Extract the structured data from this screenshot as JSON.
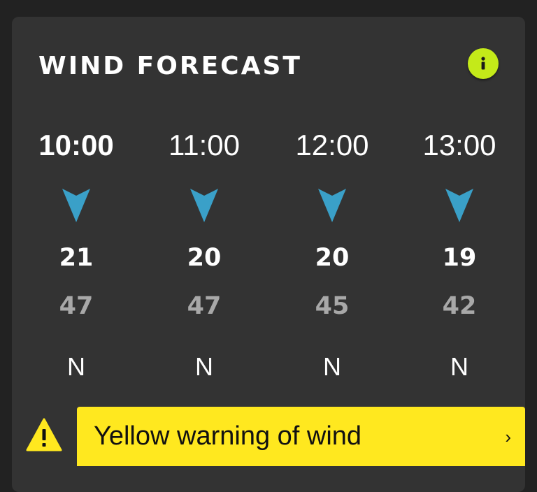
{
  "card": {
    "title": "WIND FORECAST",
    "info_icon": "info-icon"
  },
  "forecast": [
    {
      "time": "10:00",
      "speed": "21",
      "gust": "47",
      "direction": "N",
      "active": true
    },
    {
      "time": "11:00",
      "speed": "20",
      "gust": "47",
      "direction": "N",
      "active": false
    },
    {
      "time": "12:00",
      "speed": "20",
      "gust": "45",
      "direction": "N",
      "active": false
    },
    {
      "time": "13:00",
      "speed": "19",
      "gust": "42",
      "direction": "N",
      "active": false
    }
  ],
  "warning": {
    "label": "Yellow warning of wind",
    "chevron": "›",
    "warning_icon": "warning-triangle-icon"
  },
  "colors": {
    "background": "#222222",
    "card": "#333333",
    "info_accent": "#c4ea19",
    "arrow": "#3aa0c8",
    "warning_yellow": "#ffe81f",
    "gust_grey": "#a8a8a8"
  }
}
